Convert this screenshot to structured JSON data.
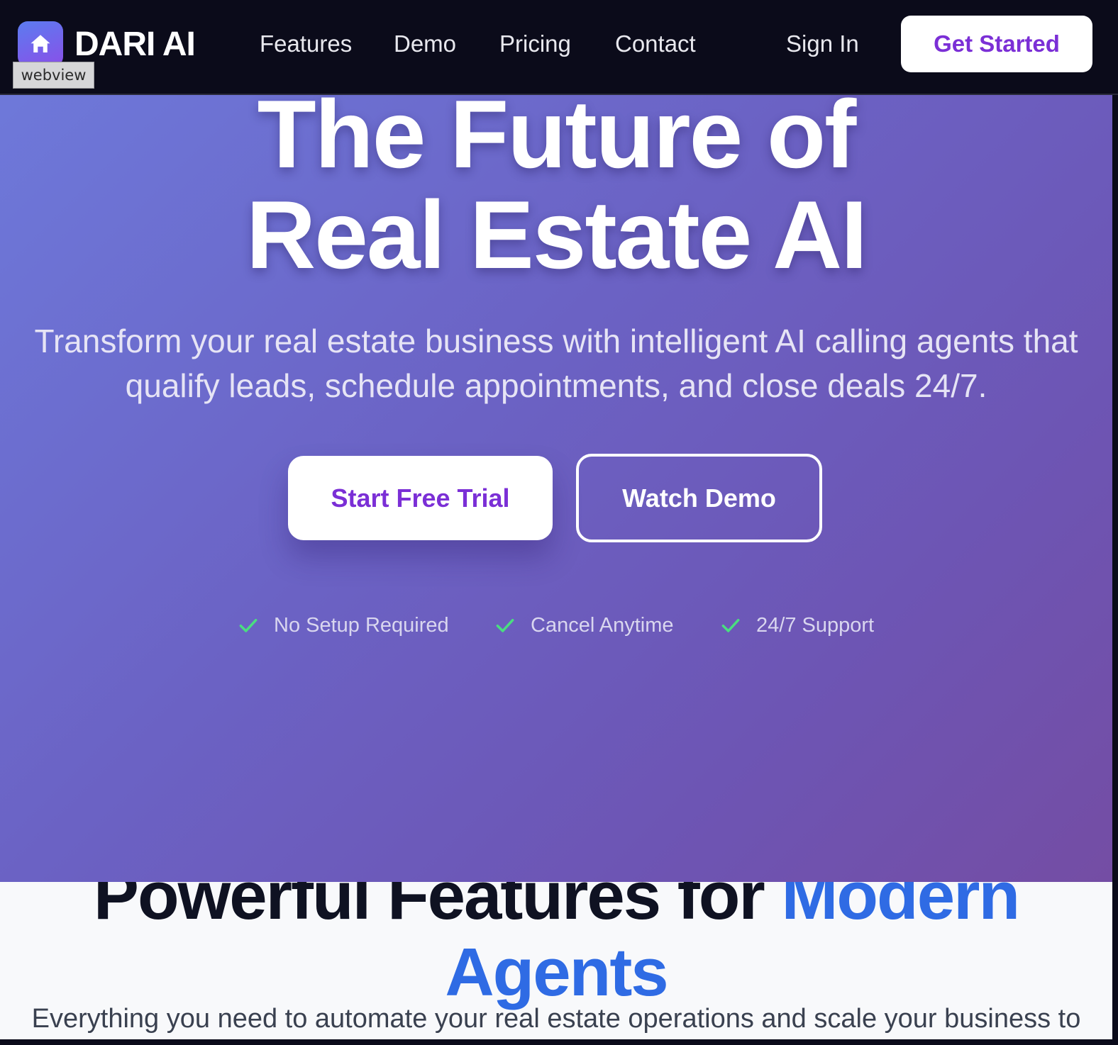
{
  "navbar": {
    "brand": "DARI AI",
    "logo_icon": "home-icon",
    "links": [
      "Features",
      "Demo",
      "Pricing",
      "Contact"
    ],
    "sign_in": "Sign In",
    "get_started": "Get Started",
    "webview_tag": "webview"
  },
  "hero": {
    "title_line1": "The Future of",
    "title_line2": "Real Estate AI",
    "subtitle": "Transform your real estate business with intelligent AI calling agents that qualify leads, schedule appointments, and close deals 24/7.",
    "primary_cta": "Start Free Trial",
    "secondary_cta": "Watch Demo",
    "checks": [
      "No Setup Required",
      "Cancel Anytime",
      "24/7 Support"
    ],
    "check_icon": "check-icon",
    "check_color": "#4ade80"
  },
  "features": {
    "title_part1": "Powerful Features for ",
    "title_accent": "Modern Agents",
    "subtitle": "Everything you need to automate your real estate operations and scale your business to"
  },
  "colors": {
    "nav_bg": "#0b0b1a",
    "accent_purple": "#7b2fd6",
    "accent_blue": "#2f6be4",
    "hero_gradient_start": "#6e7bdc",
    "hero_gradient_end": "#744da4"
  }
}
